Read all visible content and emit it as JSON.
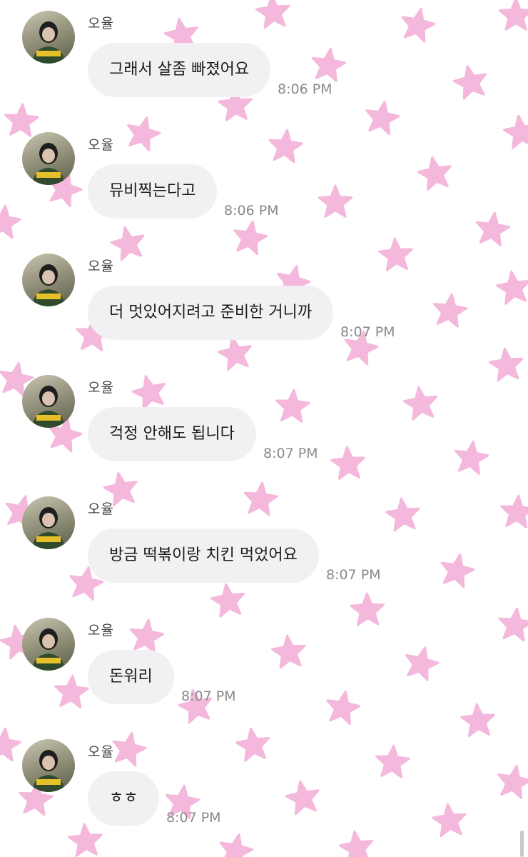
{
  "theme": {
    "background": "#ffffff",
    "star_color": "#f4b8dc",
    "bubble_color": "#f1f1f3",
    "text_color": "#1c1c1c",
    "time_color": "#8a8a8a",
    "sender_color": "#444444",
    "background_pattern": "star-icon"
  },
  "messages": [
    {
      "sender": "오율",
      "text": "그래서 살좀 빠졌어요",
      "time": "8:06 PM"
    },
    {
      "sender": "오율",
      "text": "뮤비찍는다고",
      "time": "8:06 PM"
    },
    {
      "sender": "오율",
      "text": "더 멋있어지려고 준비한 거니까",
      "time": "8:07 PM"
    },
    {
      "sender": "오율",
      "text": "걱정 안해도 됩니다",
      "time": "8:07 PM"
    },
    {
      "sender": "오율",
      "text": "방금 떡볶이랑 치킨 먹었어요",
      "time": "8:07 PM"
    },
    {
      "sender": "오율",
      "text": "돈워리",
      "time": "8:07 PM"
    },
    {
      "sender": "오율",
      "text": "ㅎㅎ",
      "time": "8:07 PM"
    }
  ]
}
